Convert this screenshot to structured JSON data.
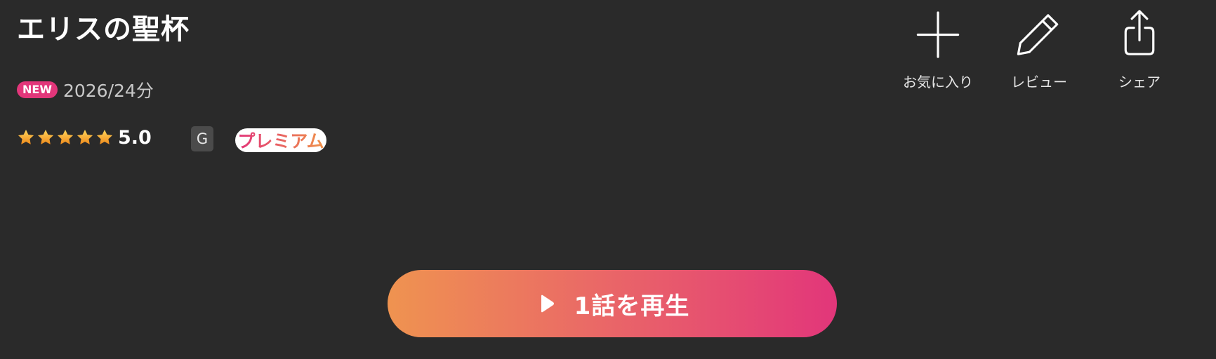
{
  "title": "エリスの聖杯",
  "meta": {
    "new_badge": "NEW",
    "info": "2026/24分"
  },
  "rating": {
    "stars": 5,
    "star_icon": "star-icon",
    "value": "5.0"
  },
  "age_rating": "G",
  "plan_badge": "プレミアム",
  "actions": {
    "favorite": {
      "label": "お気に入り",
      "icon": "plus-icon"
    },
    "review": {
      "label": "レビュー",
      "icon": "pencil-icon"
    },
    "share": {
      "label": "シェア",
      "icon": "share-icon"
    }
  },
  "play_button": {
    "label": "1話を再生",
    "icon": "play-icon"
  },
  "colors": {
    "background": "#2a2a2a",
    "accent_pink": "#e2367a",
    "accent_orange": "#ef9350",
    "star_gold": "#f2a92b",
    "age_badge_bg": "#4b4b4b"
  }
}
